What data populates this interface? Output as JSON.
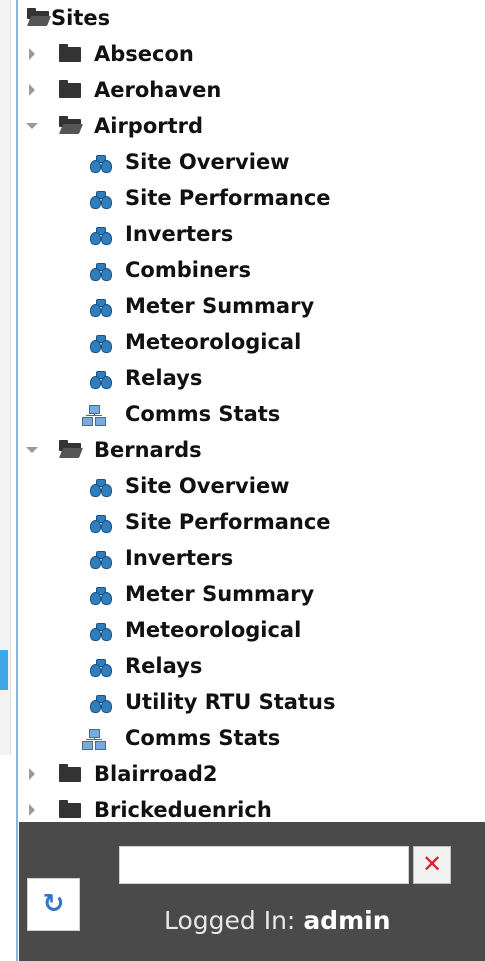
{
  "tree": {
    "root": {
      "label": "Sites",
      "icon": "folder-open-icon"
    },
    "sites": [
      {
        "label": "Absecon",
        "expanded": false,
        "children": []
      },
      {
        "label": "Aerohaven",
        "expanded": false,
        "children": []
      },
      {
        "label": "Airportrd",
        "expanded": true,
        "children": [
          {
            "label": "Site Overview",
            "icon": "binoculars-icon"
          },
          {
            "label": "Site Performance",
            "icon": "binoculars-icon"
          },
          {
            "label": "Inverters",
            "icon": "binoculars-icon"
          },
          {
            "label": "Combiners",
            "icon": "binoculars-icon"
          },
          {
            "label": "Meter Summary",
            "icon": "binoculars-icon"
          },
          {
            "label": "Meteorological",
            "icon": "binoculars-icon"
          },
          {
            "label": "Relays",
            "icon": "binoculars-icon"
          },
          {
            "label": "Comms Stats",
            "icon": "sitemap-icon"
          }
        ]
      },
      {
        "label": "Bernards",
        "expanded": true,
        "children": [
          {
            "label": "Site Overview",
            "icon": "binoculars-icon"
          },
          {
            "label": "Site Performance",
            "icon": "binoculars-icon"
          },
          {
            "label": "Inverters",
            "icon": "binoculars-icon"
          },
          {
            "label": "Meter Summary",
            "icon": "binoculars-icon"
          },
          {
            "label": "Meteorological",
            "icon": "binoculars-icon"
          },
          {
            "label": "Relays",
            "icon": "binoculars-icon"
          },
          {
            "label": "Utility RTU Status",
            "icon": "binoculars-icon"
          },
          {
            "label": "Comms Stats",
            "icon": "sitemap-icon"
          }
        ]
      },
      {
        "label": "Blairroad2",
        "expanded": false,
        "children": []
      },
      {
        "label": "Brickeduenrich",
        "expanded": false,
        "children": []
      }
    ]
  },
  "footer": {
    "search_value": "",
    "clear_label": "✕",
    "refresh_label": "↻",
    "logged_in_prefix": "Logged In: ",
    "username": "admin"
  },
  "colors": {
    "footer_bg": "#4a4a4a",
    "clear_icon": "#d62626",
    "accent_blue": "#3fa7e6",
    "binoculars": "#2f7fc0"
  }
}
